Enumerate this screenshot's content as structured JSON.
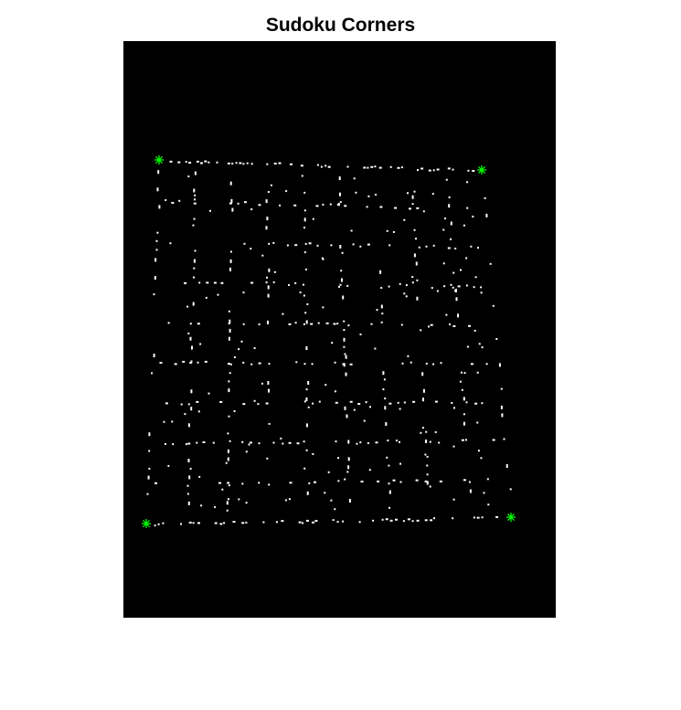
{
  "title": "Sudoku Corners",
  "colors": {
    "background": "#ffffff",
    "image_background": "#000000",
    "dots": "#ffffff",
    "corner_marker": "#00ff00"
  },
  "corners": [
    {
      "name": "top-left",
      "marker": "asterisk"
    },
    {
      "name": "top-right",
      "marker": "asterisk"
    },
    {
      "name": "bottom-left",
      "marker": "asterisk"
    },
    {
      "name": "bottom-right",
      "marker": "asterisk"
    }
  ]
}
